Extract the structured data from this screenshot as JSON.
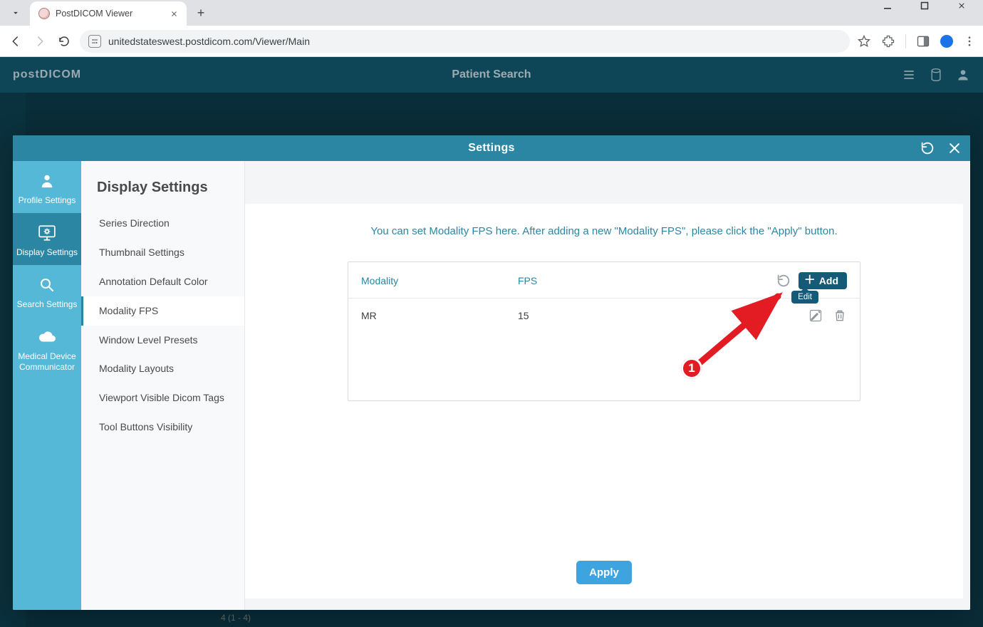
{
  "browser": {
    "tab_title": "PostDICOM Viewer",
    "url": "unitedstateswest.postdicom.com/Viewer/Main"
  },
  "background_app": {
    "logo_text": "postDICOM",
    "top_center_text": "Patient Search",
    "peek_text": "4 (1 - 4)"
  },
  "modal": {
    "title": "Settings",
    "primary_nav": [
      {
        "id": "profile",
        "label": "Profile Settings"
      },
      {
        "id": "display",
        "label": "Display Settings"
      },
      {
        "id": "search",
        "label": "Search Settings"
      },
      {
        "id": "mdc",
        "label": "Medical Device Communicator"
      }
    ],
    "primary_nav_active": "display",
    "section_title": "Display Settings",
    "secondary_nav": [
      "Series Direction",
      "Thumbnail Settings",
      "Annotation Default Color",
      "Modality FPS",
      "Window Level Presets",
      "Modality Layouts",
      "Viewport Visible Dicom Tags",
      "Tool Buttons Visibility"
    ],
    "secondary_nav_active_index": 3,
    "help_text": "You can set Modality FPS here. After adding a new \"Modality FPS\", please click the \"Apply\" button.",
    "table": {
      "col_modality": "Modality",
      "col_fps": "FPS",
      "add_label": "Add",
      "edit_tooltip": "Edit",
      "rows": [
        {
          "modality": "MR",
          "fps": "15"
        }
      ]
    },
    "apply_label": "Apply"
  },
  "annotation": {
    "step1": "1"
  },
  "colors": {
    "teal": "#2b86a3",
    "cyan": "#55b8d6",
    "darkteal": "#175a77",
    "blue": "#3ea4e0",
    "red": "#e31b23"
  }
}
